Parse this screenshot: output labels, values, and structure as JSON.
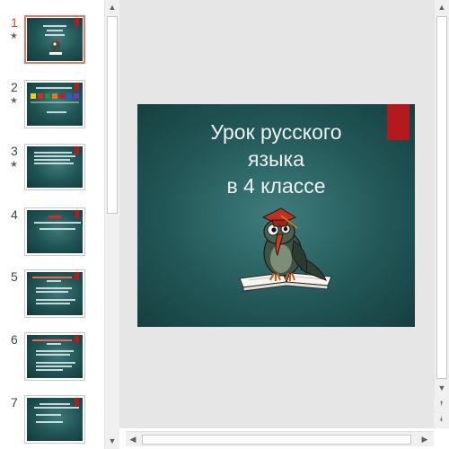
{
  "thumbnails": [
    {
      "number": "1",
      "active": true,
      "starred": true,
      "mini_title": "Урок русского языка в 4 классе"
    },
    {
      "number": "2",
      "active": false,
      "starred": true,
      "mini_title": "Словарная работа",
      "mini_text": "» свобода"
    },
    {
      "number": "3",
      "active": false,
      "starred": true,
      "mini_title": ""
    },
    {
      "number": "4",
      "active": false,
      "starred": false,
      "mini_title": "Знаки препинания и предложения"
    },
    {
      "number": "5",
      "active": false,
      "starred": false,
      "mini_title": ""
    },
    {
      "number": "6",
      "active": false,
      "starred": false,
      "mini_title": ""
    },
    {
      "number": "7",
      "active": false,
      "starred": false,
      "mini_title": ""
    }
  ],
  "star_glyph": "★",
  "slide": {
    "title_lines": [
      "Урок русского",
      "языка",
      "в 4 классе"
    ],
    "accent_color": "#b3191d",
    "background_color": "#235858",
    "illustration": "owl-on-book"
  },
  "icons": {
    "scroll_up": "▲",
    "scroll_down": "▼",
    "scroll_left": "◀",
    "scroll_right": "▶",
    "prev_slide": "⯭",
    "next_slide": "⯯"
  }
}
